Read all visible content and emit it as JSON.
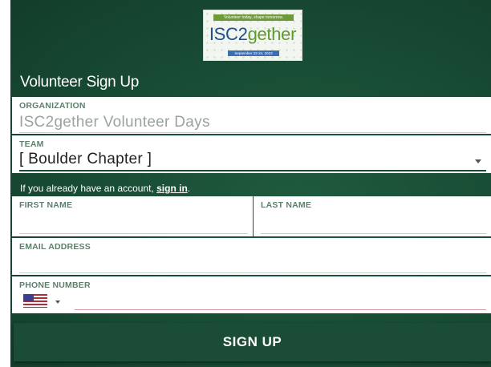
{
  "logo": {
    "tagline": "Volunteer today, shape tomorrow.",
    "wordmark_part1": "ISC2",
    "wordmark_part2": "gether",
    "dates": "September 22-24, 2023"
  },
  "page_title": "Volunteer Sign Up",
  "organization": {
    "label": "ORGANIZATION",
    "value": "ISC2gether Volunteer Days"
  },
  "team": {
    "label": "TEAM",
    "value": "[ Boulder Chapter ]"
  },
  "signin": {
    "prefix": "If you already have an account, ",
    "link": "sign in",
    "suffix": "."
  },
  "first_name": {
    "label": "FIRST NAME",
    "value": ""
  },
  "last_name": {
    "label": "LAST NAME",
    "value": ""
  },
  "email": {
    "label": "EMAIL ADDRESS",
    "value": ""
  },
  "phone": {
    "label": "PHONE NUMBER",
    "value": "",
    "country_icon": "us-flag-icon"
  },
  "submit": {
    "label": "SIGN UP"
  },
  "colors": {
    "panel_green": "#184b34",
    "label_green": "#5f7f6e",
    "logo_blue": "#1f4f8c",
    "logo_green": "#5e9a2e"
  }
}
